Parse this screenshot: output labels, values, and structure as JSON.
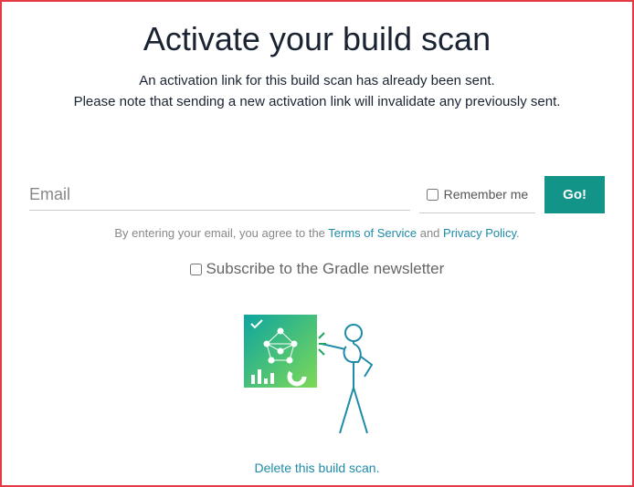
{
  "title": "Activate your build scan",
  "subtitle_line1": "An activation link for this build scan has already been sent.",
  "subtitle_line2": "Please note that sending a new activation link will invalidate any previously sent.",
  "form": {
    "email_placeholder": "Email",
    "remember_label": "Remember me",
    "go_label": "Go!"
  },
  "agree": {
    "prefix": "By entering your email, you agree to the ",
    "tos": "Terms of Service",
    "and": " and ",
    "privacy": "Privacy Policy",
    "suffix": "."
  },
  "subscribe_label": "Subscribe to the Gradle newsletter",
  "delete_label": "Delete this build scan."
}
